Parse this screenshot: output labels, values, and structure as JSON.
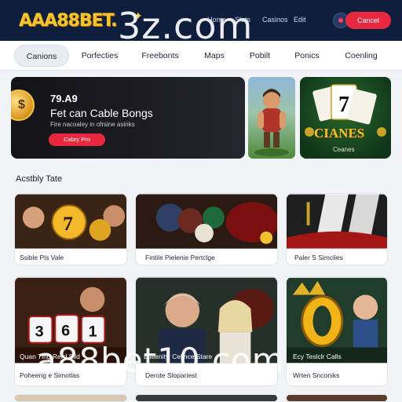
{
  "header": {
    "logo": "AAA88BET.",
    "nav": [
      "Home",
      "Slots",
      "Casinos",
      "Edit"
    ],
    "cta_label": "Cancel",
    "watermark": "3z.com"
  },
  "tabs": [
    "Canions",
    "Porfecties",
    "Freebonts",
    "Maps",
    "Pobilt",
    "Ponics",
    "Coenling"
  ],
  "hero": {
    "amount": "79.A9",
    "title": "Fet can Cable Bongs",
    "subtitle": "Fire nacoaley in ofrsine asinks",
    "cta_label": "Cabry Pro",
    "coin_symbol": "$"
  },
  "promo_card": {
    "title": "CIANES",
    "subtitle": "Ceanes",
    "card_value": "7"
  },
  "section": {
    "title": "Acstbly Tate"
  },
  "games_row1": [
    {
      "caption": "Ssible Pls Vale",
      "symbol": "7"
    },
    {
      "caption": "Fintile Pielenie Pertclge"
    },
    {
      "caption": "Paler S Simclies"
    }
  ],
  "games_row2": [
    {
      "caption": "Poheerig e Simotlas",
      "overlay": "Quan Tlng Rerd Sild",
      "dice": "3 6 1"
    },
    {
      "caption": "Derote Slopariest",
      "overlay": "Bjieenity, Cellnce Stare"
    },
    {
      "caption": "Wrten Snconiks",
      "overlay": "Ecy Teslclr Calls",
      "symbol": "0"
    }
  ],
  "watermark_bottom": "a88bet10.com",
  "colors": {
    "header_bg": "#0f1e3d",
    "accent": "#e8283f",
    "logo": "#f4c430"
  }
}
